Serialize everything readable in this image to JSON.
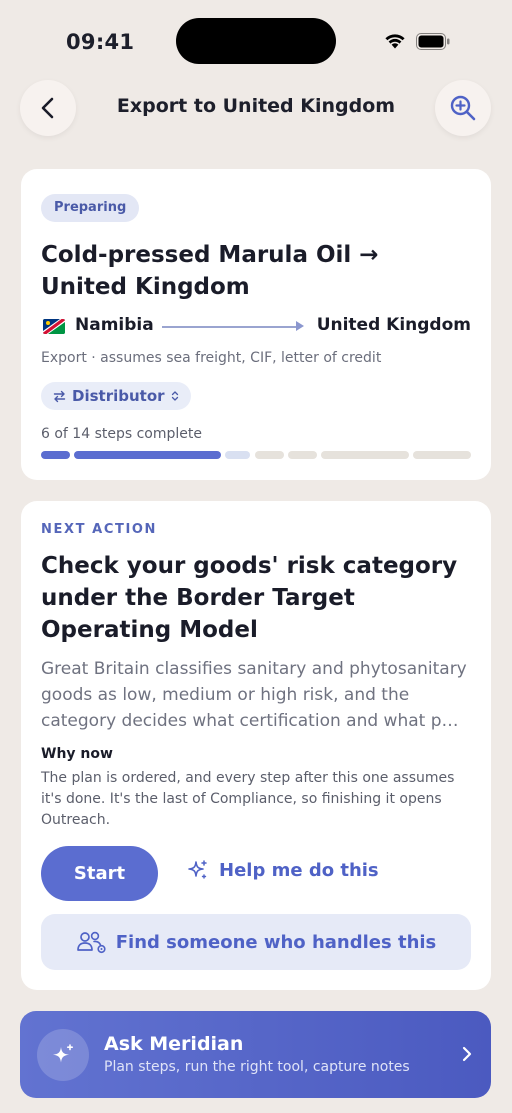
{
  "status_bar": {
    "time": "09:41"
  },
  "header": {
    "title": "Export to United Kingdom"
  },
  "route_card": {
    "status": "Preparing",
    "title": "Cold-pressed Marula Oil → United Kingdom",
    "from": "Namibia",
    "to": "United Kingdom",
    "subtitle": "Export · assumes sea freight, CIF, letter of credit",
    "chip": "Distributor",
    "progress_text": "6 of 14 steps complete",
    "steps_complete": 6,
    "steps_total": 14,
    "colors": {
      "done": "#5b6dd0",
      "partial": "#d9e0f1",
      "todo": "#e6e2dc"
    }
  },
  "next_action": {
    "eyebrow": "NEXT ACTION",
    "title": "Check your goods' risk category under the Border Target Operating Model",
    "description": "Great Britain classifies sanitary and phytosanitary goods as low, medium or high risk, and the category decides what certification and what p…",
    "why_label": "Why now",
    "why_text": "The plan is ordered, and every step after this one assumes it's done. It's the last of Compliance, so finishing it opens Outreach.",
    "start_label": "Start",
    "help_label": "Help me do this",
    "find_label": "Find someone who handles this"
  },
  "ask_bar": {
    "title": "Ask Meridian",
    "subtitle": "Plan steps, run the right tool, capture notes"
  },
  "icons": {
    "back": "chevron-left-icon",
    "zoom": "zoom-in-icon",
    "flag": "namibia-flag-icon",
    "chip": "swap-icon",
    "help": "sparkle-icon",
    "find": "people-gear-icon",
    "ask": "sparkle-icon",
    "ask_chevron": "chevron-right-icon"
  }
}
